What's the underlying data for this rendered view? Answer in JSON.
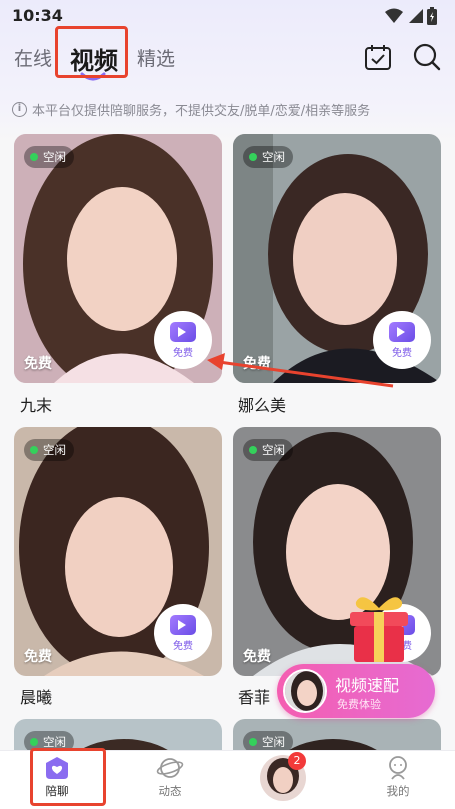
{
  "status_bar": {
    "time": "10:34"
  },
  "tabs": [
    {
      "label": "在线",
      "active": false
    },
    {
      "label": "视频",
      "active": true
    },
    {
      "label": "精选",
      "active": false
    }
  ],
  "notice": "本平台仅提供陪聊服务，不提供交友/脱单/恋爱/相亲等服务",
  "cards": [
    {
      "name": "九末",
      "status": "空闲",
      "free_label": "免费",
      "video_label": "免费"
    },
    {
      "name": "娜么美",
      "status": "空闲",
      "free_label": "免费",
      "video_label": "免费"
    },
    {
      "name": "晨曦",
      "status": "空闲",
      "free_label": "免费",
      "video_label": "免费"
    },
    {
      "name": "香菲",
      "status": "空闲",
      "free_label": "免费",
      "video_label": "免费"
    },
    {
      "name": "",
      "status": "空闲"
    },
    {
      "name": "",
      "status": "空闲"
    }
  ],
  "match": {
    "title": "视频速配",
    "subtitle": "免费体验"
  },
  "bottom_nav": [
    {
      "label": "陪聊",
      "icon": "heart-chat-icon",
      "active": true
    },
    {
      "label": "动态",
      "icon": "planet-icon",
      "active": false
    },
    {
      "label": "",
      "icon": "avatar",
      "active": false,
      "badge": "2"
    },
    {
      "label": "我的",
      "icon": "profile-icon",
      "active": false
    }
  ],
  "colors": {
    "accent": "#7a56e8",
    "highlight": "#e8432e",
    "online": "#34d15b",
    "match_pink": "#f45eb1"
  }
}
